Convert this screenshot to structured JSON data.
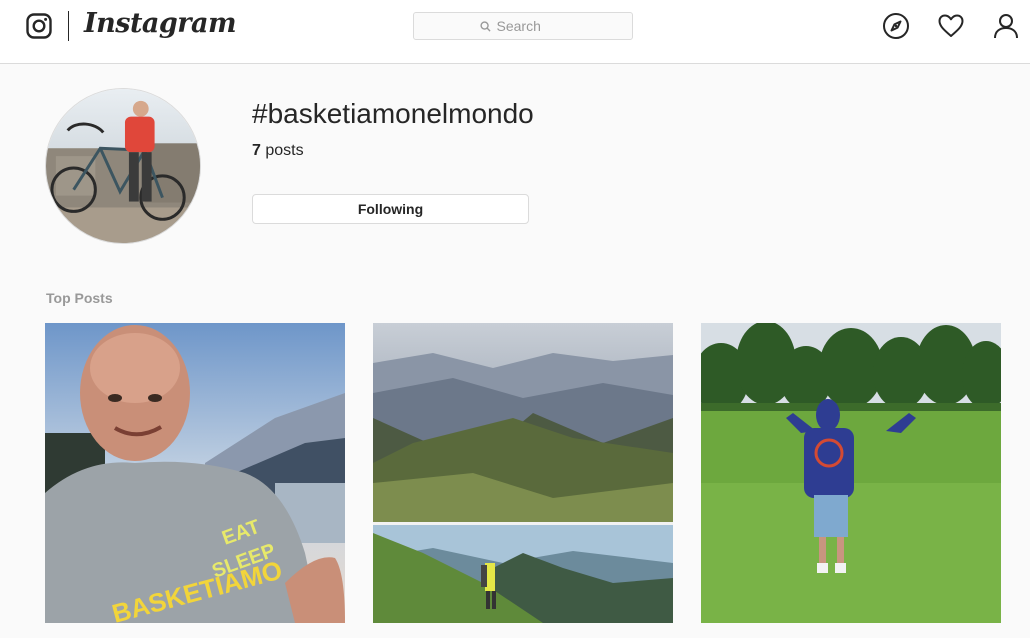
{
  "nav": {
    "logo_text": "Instagram",
    "search_placeholder": "Search",
    "icons": [
      "instagram-glyph-icon",
      "search-icon",
      "compass-icon",
      "heart-icon",
      "profile-icon"
    ]
  },
  "header": {
    "hashtag": "#basketiamonelmondo",
    "post_count_number": "7",
    "post_count_label": "posts",
    "follow_button_label": "Following"
  },
  "sections": {
    "top_posts_label": "Top Posts"
  },
  "posts": [
    {
      "label": "Top post 1"
    },
    {
      "label": "Top post 2"
    },
    {
      "label": "Top post 3"
    }
  ],
  "colors": {
    "nav_background": "#ffffff",
    "page_background": "#fafafa",
    "text_primary": "#262626",
    "text_secondary": "#999999",
    "border": "#dbdbdb"
  }
}
